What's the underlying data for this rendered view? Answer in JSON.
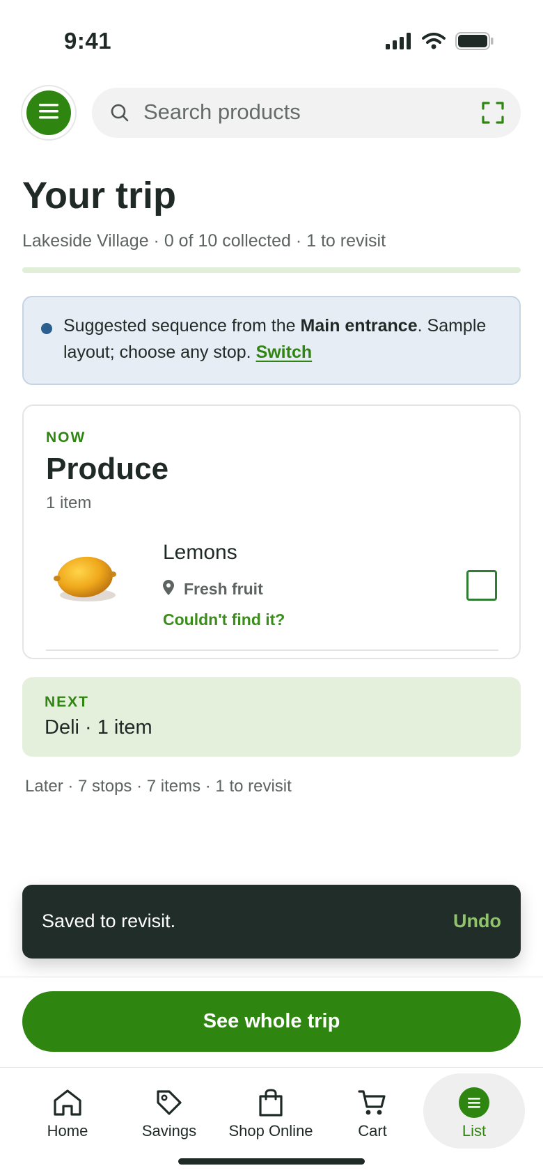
{
  "status_bar": {
    "time": "9:41"
  },
  "search": {
    "placeholder": "Search products"
  },
  "trip": {
    "title": "Your trip",
    "subtitle": "Lakeside Village · 0 of 10 collected · 1 to revisit",
    "collected": 0,
    "total": 10
  },
  "banner": {
    "text_before": "Suggested sequence from the ",
    "bold": "Main entrance",
    "text_after": ". Sample layout; choose any stop. ",
    "link": "Switch"
  },
  "now": {
    "eyebrow": "NOW",
    "aisle": "Produce",
    "count": "1 item",
    "item": {
      "name": "Lemons",
      "location": "Fresh fruit",
      "cant_find": "Couldn't find it?",
      "checked": false
    }
  },
  "next": {
    "eyebrow": "NEXT",
    "title": "Deli · 1 item"
  },
  "later": "Later · 7 stops · 7 items · 1 to revisit",
  "toast": {
    "message": "Saved to revisit.",
    "action": "Undo"
  },
  "cta": {
    "label": "See whole trip"
  },
  "nav": {
    "items": [
      {
        "label": "Home",
        "icon": "home-icon"
      },
      {
        "label": "Savings",
        "icon": "tag-icon"
      },
      {
        "label": "Shop Online",
        "icon": "bag-icon"
      },
      {
        "label": "Cart",
        "icon": "cart-icon"
      },
      {
        "label": "List",
        "icon": "list-icon"
      }
    ],
    "active": "List"
  },
  "colors": {
    "brand_green": "#2e8510",
    "dark": "#1f2a27",
    "toast_bg": "#212d28",
    "banner_bg": "#e7edf4",
    "next_bg": "#e4f0dc"
  }
}
